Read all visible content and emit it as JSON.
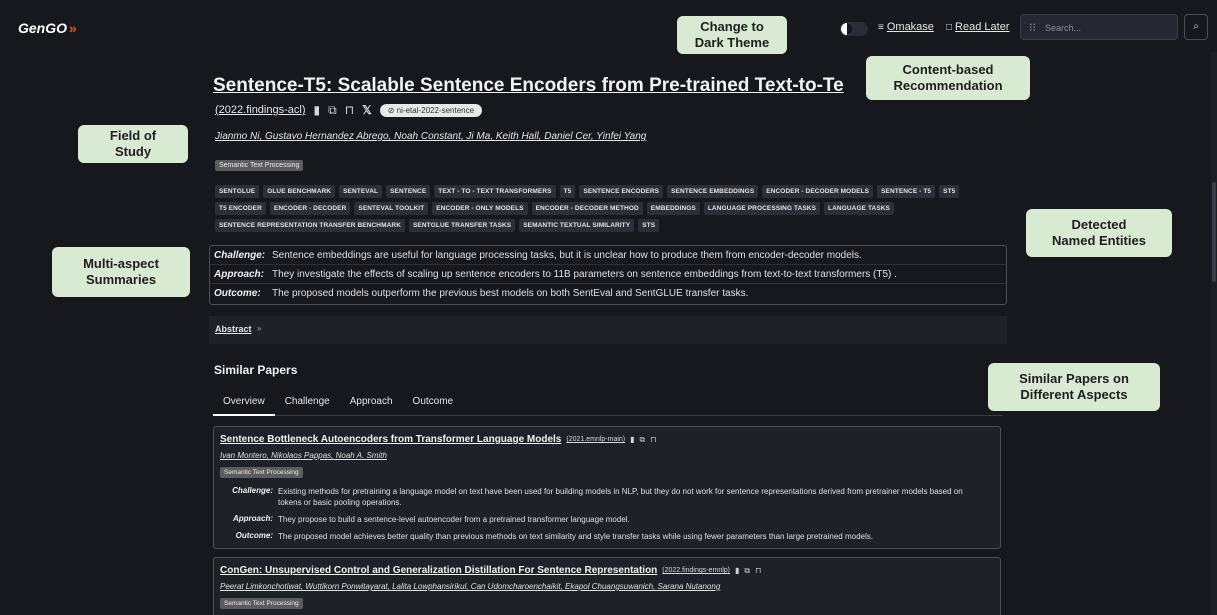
{
  "header": {
    "logo_text": "GenGO",
    "logo_chevron": "»",
    "theme_toggle_icon": "half-moon-toggle",
    "omakase_label": "Omakase",
    "omakase_icon": "≡",
    "read_later_label": "Read Later",
    "read_later_icon": "□",
    "search_placeholder": "Search...",
    "search_icon": "⌕",
    "search_button_icon": "⌕"
  },
  "paper": {
    "title": "Sentence-T5: Scalable Sentence Encoders from Pre-trained Text-to-Te",
    "venue": "(2022.findings-acl)",
    "citation_key": "ni-etal-2022-sentence",
    "authors": "Jianmo Ni, Gustavo Hernandez Abrego, Noah Constant, Ji Ma, Keith Hall, Daniel Cer, Yinfei Yang",
    "field_tag": "Semantic Text Processing",
    "entities": [
      "SENTGLUE",
      "GLUE BENCHMARK",
      "SENTEVAL",
      "SENTENCE",
      "TEXT - TO - TEXT TRANSFORMERS",
      "T5",
      "SENTENCE ENCODERS",
      "SENTENCE EMBEDDINGS",
      "ENCODER - DECODER MODELS",
      "SENTENCE - T5",
      "ST5",
      "T5 ENCODER",
      "ENCODER - DECODER",
      "SENTEVAL TOOLKIT",
      "ENCODER - ONLY MODELS",
      "ENCODER - DECODER METHOD",
      "EMBEDDINGS",
      "LANGUAGE PROCESSING TASKS",
      "LANGUAGE TASKS",
      "SENTENCE REPRESENTATION TRANSFER BENCHMARK",
      "SENTGLUE TRANSFER TASKS",
      "SEMANTIC TEXTUAL SIMILARITY",
      "STS"
    ],
    "summary": [
      {
        "label": "Challenge:",
        "text": "Sentence embeddings are useful for language processing tasks, but it is unclear how to produce them from encoder-decoder models."
      },
      {
        "label": "Approach:",
        "text": "They investigate the effects of scaling up sentence encoders to 11B parameters on sentence embeddings from text-to-text transformers (T5) ."
      },
      {
        "label": "Outcome:",
        "text": "The proposed models outperform the previous best models on both SentEval and SentGLUE transfer tasks."
      }
    ],
    "abstract_label": "Abstract",
    "abstract_chevron": "»"
  },
  "similar": {
    "heading": "Similar Papers",
    "tabs": [
      "Overview",
      "Challenge",
      "Approach",
      "Outcome"
    ],
    "papers": [
      {
        "title": "Sentence Bottleneck Autoencoders from Transformer Language Models",
        "venue": "(2021.emnlp-main)",
        "authors": "Ivan Montero, Nikolaos Pappas, Noah A. Smith",
        "tag": "Semantic Text Processing",
        "challenge_label": "Challenge:",
        "challenge": "Existing methods for pretraining a language model on text have been used for building models in NLP, but they do not work for sentence representations derived from pretrainer models based on tokens or basic pooling operations.",
        "approach_label": "Approach:",
        "approach": "They propose to build a sentence-level autoencoder from a pretrained transformer language model.",
        "outcome_label": "Outcome:",
        "outcome": "The proposed model achieves better quality than previous methods on text similarity and style transfer tasks while using fewer parameters than large pretrained models."
      },
      {
        "title": "ConGen: Unsupervised Control and Generalization Distillation For Sentence Representation",
        "venue": "(2022.findings-emnlp)",
        "authors": "Peerat Limkonchotiwat, Wuttikorn Ponwitayarat, Lalita Lowphansirikul, Can Udomcharoenchaikit, Ekapol Chuangsuwanich, Sarana Nutanong",
        "tag": "Semantic Text Processing"
      }
    ]
  },
  "callouts": {
    "dark_theme": "Change to\nDark Theme",
    "content_rec": "Content-based\nRecommendation",
    "field_of_study": "Field of\nStudy",
    "named_entities": "Detected\nNamed Entities",
    "multi_aspect": "Multi-aspect\nSummaries",
    "similar_aspects": "Similar Papers on\nDifferent Aspects"
  },
  "colors": {
    "background": "#16181e",
    "callout_bg": "#d9ead3",
    "logo_accent": "#e05a2c",
    "tag_bg": "#5d5c5c"
  }
}
